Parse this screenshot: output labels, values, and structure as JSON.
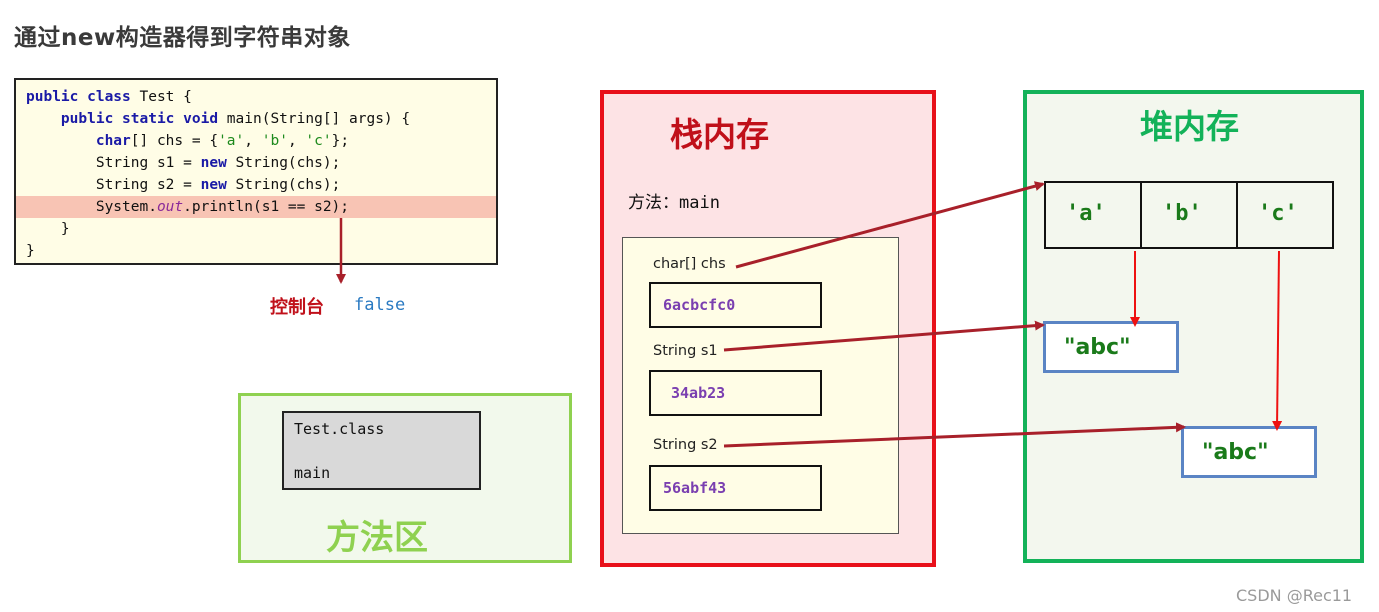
{
  "title": "通过new构造器得到字符串对象",
  "code": {
    "lines": [
      [
        {
          "t": "public class",
          "c": "kw"
        },
        {
          "t": " Test {"
        }
      ],
      [
        {
          "t": "    "
        },
        {
          "t": "public static void",
          "c": "kw"
        },
        {
          "t": " main(String[] args) {"
        }
      ],
      [
        {
          "t": "        "
        },
        {
          "t": "char",
          "c": "kw"
        },
        {
          "t": "[] chs = {"
        },
        {
          "t": "'a'",
          "c": "str"
        },
        {
          "t": ", "
        },
        {
          "t": "'b'",
          "c": "str"
        },
        {
          "t": ", "
        },
        {
          "t": "'c'",
          "c": "str"
        },
        {
          "t": "};"
        }
      ],
      [
        {
          "t": "        String s1 = "
        },
        {
          "t": "new",
          "c": "kw"
        },
        {
          "t": " String(chs);"
        }
      ],
      [
        {
          "t": "        String s2 = "
        },
        {
          "t": "new",
          "c": "kw"
        },
        {
          "t": " String(chs);"
        }
      ],
      [
        {
          "t": "        System."
        },
        {
          "t": "out",
          "c": "it"
        },
        {
          "t": ".println(s1 == s2);"
        }
      ],
      [
        {
          "t": "    }"
        }
      ],
      [
        {
          "t": "}"
        }
      ]
    ],
    "highlighted_line": 5
  },
  "console": {
    "label": "控制台",
    "value": "false"
  },
  "method_area": {
    "label": "方法区",
    "class_name": "Test.class",
    "method": "main"
  },
  "stack": {
    "label": "栈内存",
    "method_prefix": "方法：",
    "method_name": "main",
    "vars": [
      {
        "name": "char[]  chs",
        "address": "6acbcfc0"
      },
      {
        "name": "String  s1",
        "address": "34ab23"
      },
      {
        "name": "String  s2",
        "address": "56abf43"
      }
    ]
  },
  "heap": {
    "label": "堆内存",
    "array": [
      "'a'",
      "'b'",
      "'c'"
    ],
    "strings": [
      "\"abc\"",
      "\"abc\""
    ]
  },
  "colors": {
    "stack_border": "#e8101a",
    "heap_border": "#13b259",
    "method_area_border": "#8fd150",
    "reference_arrow": "#a8202a",
    "value_arrow": "#ee1111",
    "address_text": "#7a3fb0"
  },
  "watermark": "CSDN @Rec11"
}
